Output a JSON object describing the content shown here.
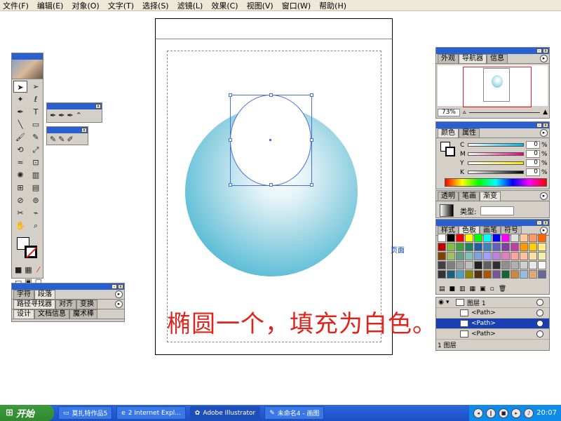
{
  "menu": [
    "文件(F)",
    "编辑(E)",
    "对象(O)",
    "文字(T)",
    "选择(S)",
    "滤镜(L)",
    "效果(C)",
    "视图(V)",
    "窗口(W)",
    "帮助(H)"
  ],
  "canvas": {
    "page_label": "页面",
    "caption": "椭圆一个，填充为白色。",
    "gradient_colors": [
      "#ffffff",
      "#64c0d8",
      "#2aa6c4"
    ],
    "selection_color": "#4a6fd8"
  },
  "tools": {
    "icons": [
      "selection-arrow",
      "direct-select",
      "magic-wand",
      "lasso",
      "pen",
      "type",
      "line",
      "rectangle",
      "paintbrush",
      "pencil",
      "rotate",
      "scale",
      "warp",
      "free-transform",
      "symbol-sprayer",
      "graph",
      "mesh",
      "gradient",
      "eyedropper",
      "blend",
      "scissors",
      "knife",
      "hand",
      "zoom"
    ]
  },
  "char_panel": {
    "row1_tabs": [
      "字符",
      "段落"
    ],
    "row2_tabs": [
      "路径寻找器",
      "对齐",
      "变换"
    ],
    "row3_tabs": [
      "设计",
      "文档信息",
      "魔术棒"
    ]
  },
  "nav_panel": {
    "tabs": [
      "外观",
      "导航器",
      "信息"
    ],
    "zoom": "73%"
  },
  "color_panel": {
    "tabs": [
      "颜色",
      "属性"
    ],
    "channels": [
      {
        "label": "C",
        "value": "0",
        "color": "#00b4e6"
      },
      {
        "label": "M",
        "value": "0",
        "color": "#e6007e"
      },
      {
        "label": "Y",
        "value": "0",
        "color": "#ffe800"
      },
      {
        "label": "K",
        "value": "0",
        "color": "#000000"
      }
    ]
  },
  "gradient_panel": {
    "tabs": [
      "透明",
      "笔画",
      "渐变"
    ],
    "type_label": "类型:"
  },
  "swatch_panel": {
    "tabs": [
      "样式",
      "色板",
      "画笔",
      "符号"
    ]
  },
  "layers_panel": {
    "layer_name": "图层 1",
    "rows": [
      {
        "name": "<Path>",
        "selected": false
      },
      {
        "name": "<Path>",
        "selected": true
      },
      {
        "name": "<Path>",
        "selected": false
      }
    ],
    "footer": "1 图层"
  },
  "taskbar": {
    "start": "开始",
    "buttons": [
      "莫扎特作品5",
      "2 Internet Expl...",
      "Adobe Illustrator",
      "未命名4 - 画图"
    ],
    "active_index": 2,
    "time": "20:07"
  }
}
